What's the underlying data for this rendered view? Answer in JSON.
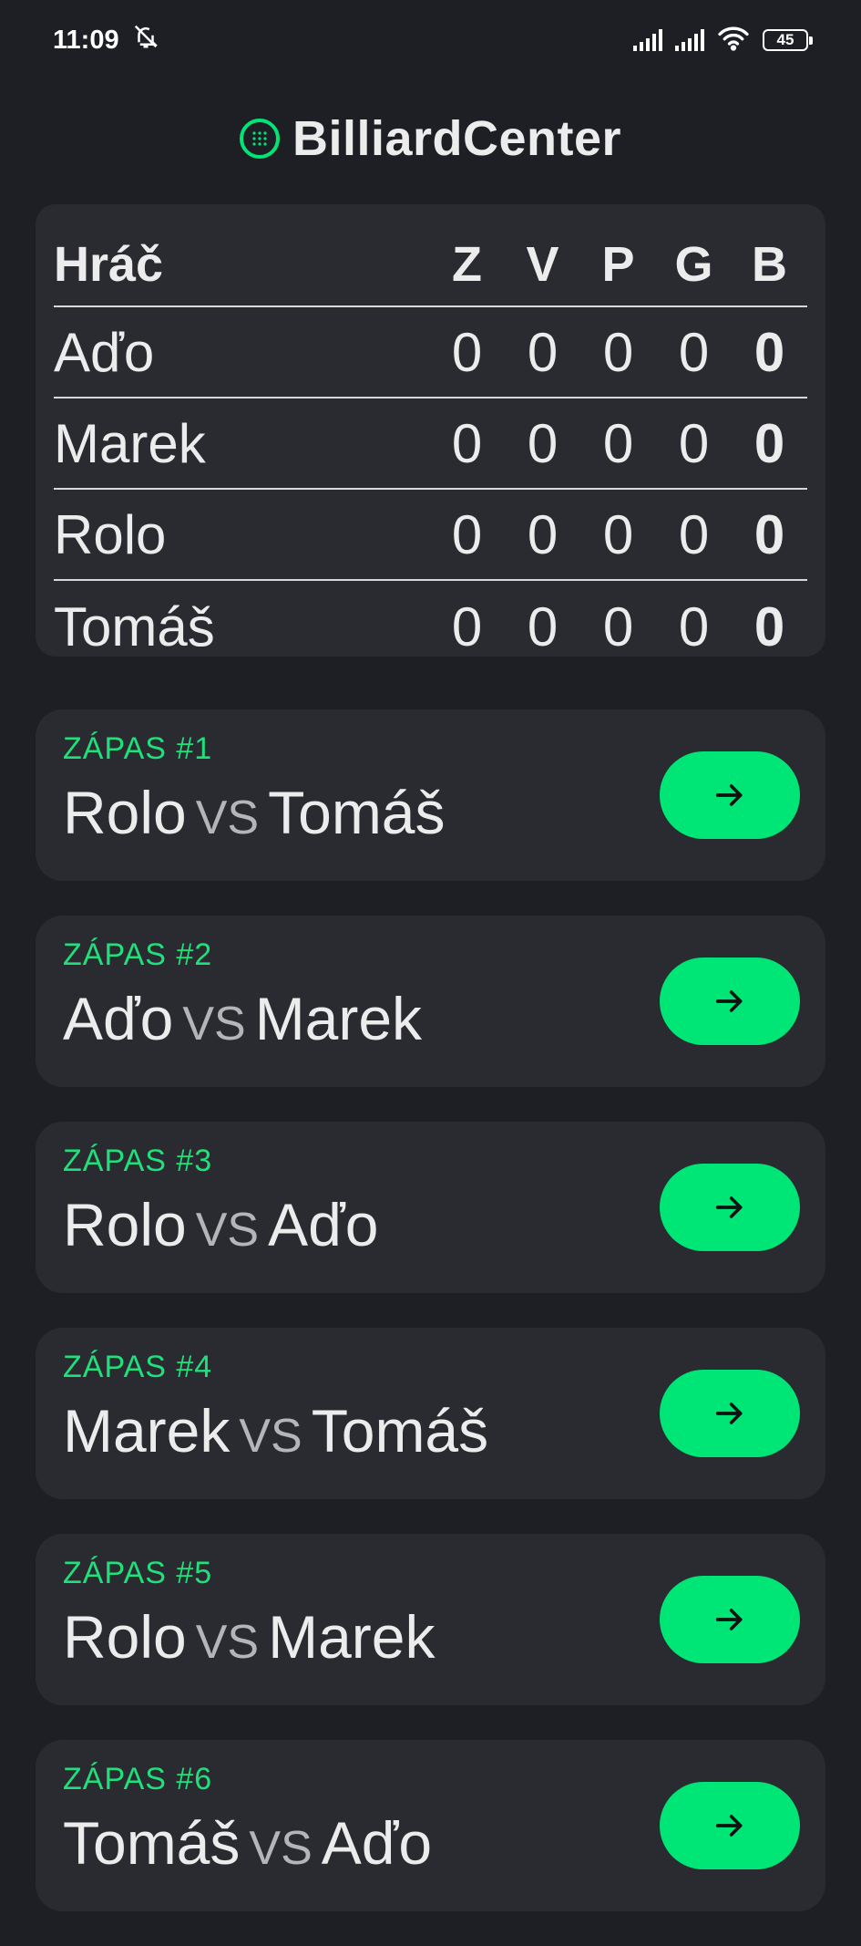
{
  "status_bar": {
    "time": "11:09",
    "battery": "45"
  },
  "header": {
    "title": "BilliardCenter"
  },
  "colors": {
    "background": "#1e1f25",
    "card": "#2a2b31",
    "accent": "#00e676"
  },
  "standings": {
    "columns": [
      "Hráč",
      "Z",
      "V",
      "P",
      "G",
      "B"
    ],
    "rows": [
      {
        "player": "Aďo",
        "z": "0",
        "v": "0",
        "p": "0",
        "g": "0",
        "b": "0"
      },
      {
        "player": "Marek",
        "z": "0",
        "v": "0",
        "p": "0",
        "g": "0",
        "b": "0"
      },
      {
        "player": "Rolo",
        "z": "0",
        "v": "0",
        "p": "0",
        "g": "0",
        "b": "0"
      },
      {
        "player": "Tomáš",
        "z": "0",
        "v": "0",
        "p": "0",
        "g": "0",
        "b": "0"
      }
    ]
  },
  "matches": [
    {
      "label": "ZÁPAS #1",
      "player1": "Rolo",
      "vs": "VS",
      "player2": "Tomáš",
      "action_icon": "arrow-right-icon"
    },
    {
      "label": "ZÁPAS #2",
      "player1": "Aďo",
      "vs": "VS",
      "player2": "Marek",
      "action_icon": "arrow-right-icon"
    },
    {
      "label": "ZÁPAS #3",
      "player1": "Rolo",
      "vs": "VS",
      "player2": "Aďo",
      "action_icon": "arrow-right-icon"
    },
    {
      "label": "ZÁPAS #4",
      "player1": "Marek",
      "vs": "VS",
      "player2": "Tomáš",
      "action_icon": "arrow-right-icon"
    },
    {
      "label": "ZÁPAS #5",
      "player1": "Rolo",
      "vs": "VS",
      "player2": "Marek",
      "action_icon": "arrow-right-icon"
    },
    {
      "label": "ZÁPAS #6",
      "player1": "Tomáš",
      "vs": "VS",
      "player2": "Aďo",
      "action_icon": "arrow-right-icon"
    }
  ]
}
